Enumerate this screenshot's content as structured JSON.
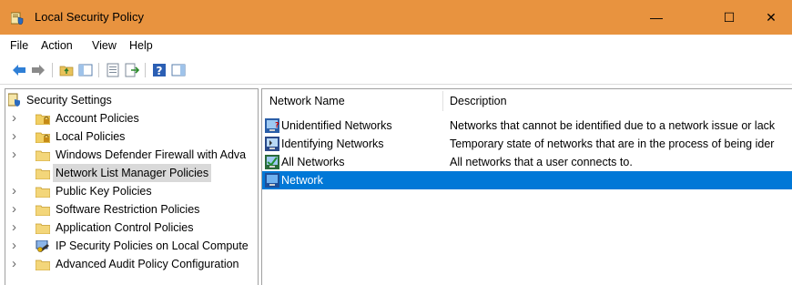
{
  "window": {
    "title": "Local Security Policy",
    "controls": {
      "minimize": "—",
      "maximize": "☐",
      "close": "✕"
    }
  },
  "menu": [
    "File",
    "Action",
    "View",
    "Help"
  ],
  "toolbar": {
    "icons": [
      "back-arrow-icon",
      "forward-arrow-icon",
      "up-folder-icon",
      "show-hide-tree-icon",
      "properties-icon",
      "export-list-icon",
      "help-icon",
      "show-hide-action-pane-icon"
    ]
  },
  "tree": {
    "root": "Security Settings",
    "items": [
      {
        "label": "Account Policies",
        "has_children": true,
        "icon": "folder-lock-icon"
      },
      {
        "label": "Local Policies",
        "has_children": true,
        "icon": "folder-lock-icon"
      },
      {
        "label": "Windows Defender Firewall with Adva",
        "has_children": true,
        "icon": "folder-icon"
      },
      {
        "label": "Network List Manager Policies",
        "has_children": false,
        "icon": "folder-icon",
        "selected": true
      },
      {
        "label": "Public Key Policies",
        "has_children": true,
        "icon": "folder-icon"
      },
      {
        "label": "Software Restriction Policies",
        "has_children": true,
        "icon": "folder-icon"
      },
      {
        "label": "Application Control Policies",
        "has_children": true,
        "icon": "folder-icon"
      },
      {
        "label": "IP Security Policies on Local Compute",
        "has_children": true,
        "icon": "ip-security-icon"
      },
      {
        "label": "Advanced Audit Policy Configuration",
        "has_children": true,
        "icon": "folder-icon"
      }
    ]
  },
  "list": {
    "columns": [
      "Network Name",
      "Description"
    ],
    "rows": [
      {
        "name": "Unidentified Networks",
        "description": "Networks that cannot be identified due to a network issue or lack",
        "icon": "unidentified-network-icon",
        "selected": false
      },
      {
        "name": "Identifying Networks",
        "description": "Temporary state of networks that are in the process of being ider",
        "icon": "identifying-network-icon",
        "selected": false
      },
      {
        "name": "All Networks",
        "description": "All networks that a user connects to.",
        "icon": "all-networks-icon",
        "selected": false
      },
      {
        "name": "Network",
        "description": "",
        "icon": "network-icon",
        "selected": true
      }
    ]
  },
  "colors": {
    "titlebar": "#e8933f",
    "selection": "#0078d7",
    "tree_selection": "#d9d9d9"
  }
}
